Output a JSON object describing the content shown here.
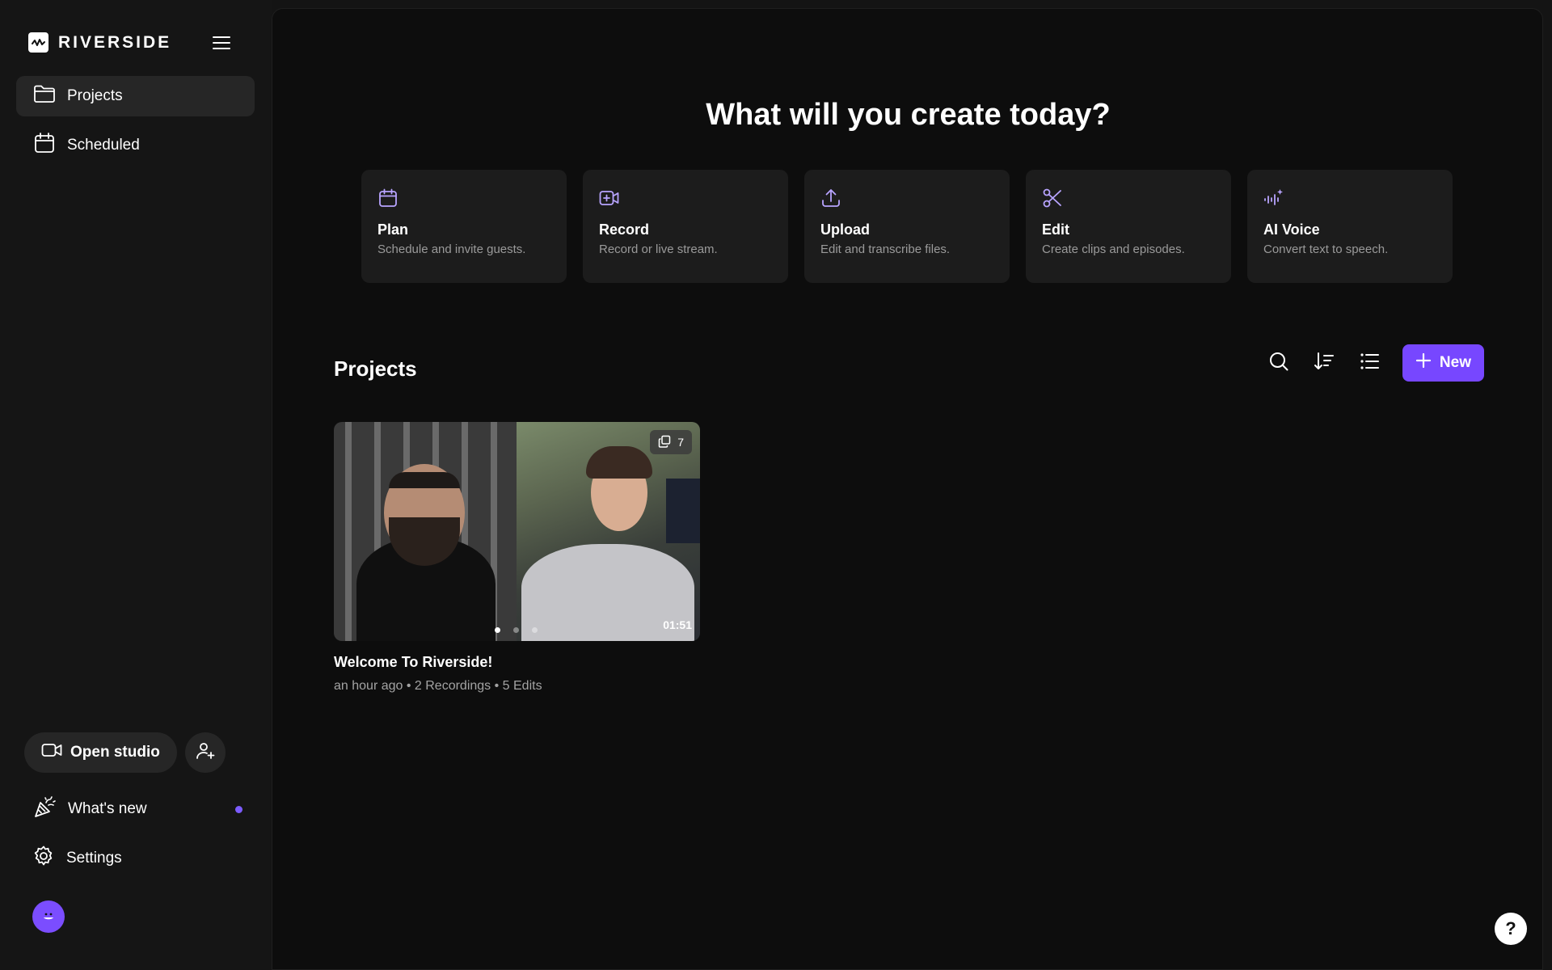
{
  "brand": {
    "name": "RIVERSIDE"
  },
  "sidebar": {
    "items": [
      {
        "label": "Projects",
        "icon": "folder-icon",
        "active": true
      },
      {
        "label": "Scheduled",
        "icon": "calendar-icon",
        "active": false
      }
    ],
    "open_studio_label": "Open studio",
    "bottom_items": [
      {
        "label": "What's new",
        "icon": "party-popper-icon",
        "badge": true
      },
      {
        "label": "Settings",
        "icon": "gear-icon"
      }
    ]
  },
  "main": {
    "headline": "What will you create today?",
    "cards": [
      {
        "title": "Plan",
        "desc": "Schedule and invite guests.",
        "icon": "calendar-icon"
      },
      {
        "title": "Record",
        "desc": "Record or live stream.",
        "icon": "video-plus-icon"
      },
      {
        "title": "Upload",
        "desc": "Edit and transcribe files.",
        "icon": "upload-icon"
      },
      {
        "title": "Edit",
        "desc": "Create clips and episodes.",
        "icon": "scissors-icon"
      },
      {
        "title": "AI Voice",
        "desc": "Convert text to speech.",
        "icon": "ai-voice-icon"
      }
    ],
    "projects_title": "Projects",
    "new_label": "New",
    "project": {
      "name": "Welcome To Riverside!",
      "meta": "an hour ago • 2 Recordings • 5 Edits",
      "count": "7",
      "duration": "01:51"
    },
    "help": "?"
  },
  "colors": {
    "accent": "#7747ff",
    "background": "#0d0d0d",
    "sidebar": "#151515",
    "card": "#1c1c1c"
  }
}
